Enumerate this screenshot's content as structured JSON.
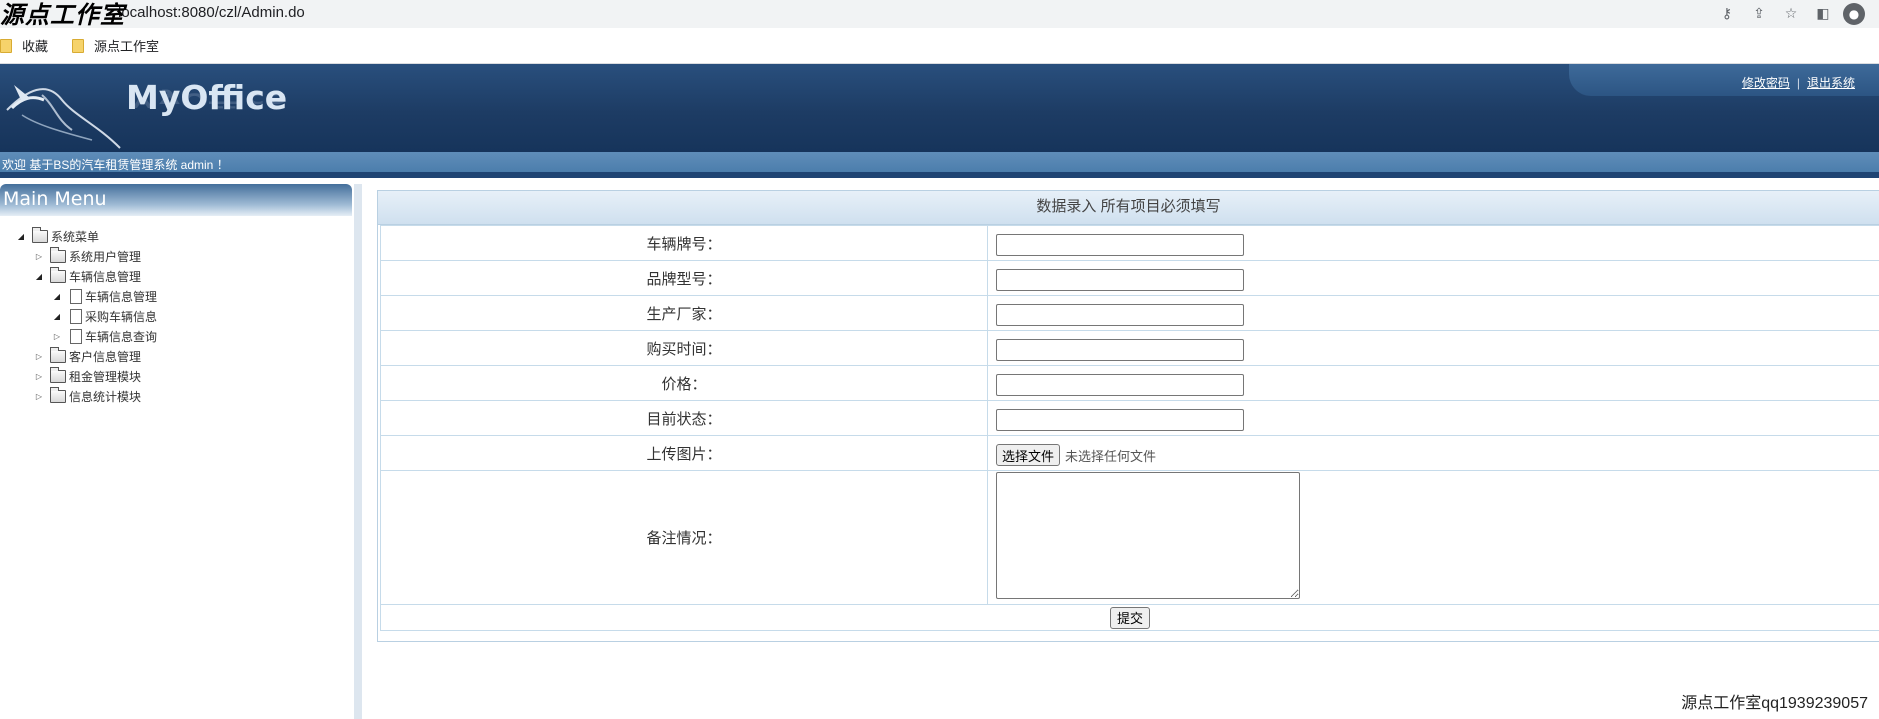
{
  "browser": {
    "url": "localhost:8080/czl/Admin.do",
    "bookmarks": [
      "收藏",
      "源点工作室"
    ]
  },
  "watermark": {
    "top": "源点工作室",
    "bottom": "源点工作室qq1939239057"
  },
  "header": {
    "logo": "MyOffice",
    "links": [
      "修改密码",
      "退出系统"
    ],
    "welcome": "欢迎 基于BS的汽车租赁管理系统 admin ！"
  },
  "sidebar": {
    "title": "Main Menu",
    "tree": [
      {
        "label": "系统菜单",
        "level": 0,
        "kind": "folder",
        "state": "open"
      },
      {
        "label": "系统用户管理",
        "level": 1,
        "kind": "folder",
        "state": "closed"
      },
      {
        "label": "车辆信息管理",
        "level": 1,
        "kind": "folder",
        "state": "open"
      },
      {
        "label": "车辆信息管理",
        "level": 2,
        "kind": "doc",
        "state": "open"
      },
      {
        "label": "采购车辆信息",
        "level": 2,
        "kind": "doc",
        "state": "open"
      },
      {
        "label": "车辆信息查询",
        "level": 2,
        "kind": "doc",
        "state": "closed"
      },
      {
        "label": "客户信息管理",
        "level": 1,
        "kind": "folder",
        "state": "closed"
      },
      {
        "label": "租金管理模块",
        "level": 1,
        "kind": "folder",
        "state": "closed"
      },
      {
        "label": "信息统计模块",
        "level": 1,
        "kind": "folder",
        "state": "closed"
      }
    ]
  },
  "form": {
    "header": "数据录入  所有项目必须填写",
    "fields": [
      {
        "label": "车辆牌号：",
        "value": ""
      },
      {
        "label": "品牌型号：",
        "value": ""
      },
      {
        "label": "生产厂家：",
        "value": ""
      },
      {
        "label": "购买时间：",
        "value": ""
      },
      {
        "label": "价格：",
        "value": ""
      },
      {
        "label": "目前状态：",
        "value": ""
      }
    ],
    "upload": {
      "label": "上传图片：",
      "button": "选择文件",
      "status": "未选择任何文件"
    },
    "remarks": {
      "label": "备注情况：",
      "value": ""
    },
    "submit": "提交"
  }
}
